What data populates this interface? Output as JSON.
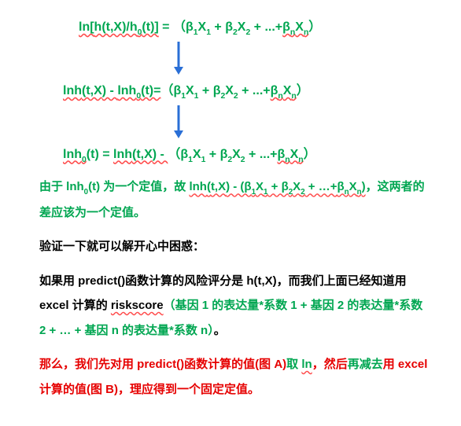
{
  "eq1": {
    "lhs_a": "ln[",
    "lhs_b": "h(t,X",
    "lhs_c": ")/h",
    "lhs_d": "(t)]",
    "eq": " = ",
    "open": "（",
    "t1a": "β",
    "t1b": "X",
    "plus1": " + ",
    "t2a": "β",
    "t2b": "X",
    "plus2": " + ...+",
    "tna": "β",
    "tnb": "X",
    "close": "）",
    "s1": "1",
    "s2": "2",
    "sn": "n",
    "s0": "0"
  },
  "eq2": {
    "lhs_a": "lnh",
    "lhs_b": "(t,X",
    "lhs_c": ") - ",
    "lhs_d": "lnh",
    "lhs_e": "(t)=",
    "open": "（",
    "t1a": "β",
    "t1b": "X",
    "plus1": " + ",
    "t2a": "β",
    "t2b": "X",
    "plus2": " + ...+",
    "tna": "β",
    "tnb": "X",
    "close": "）",
    "s1": "1",
    "s2": "2",
    "sn": "n",
    "s0": "0"
  },
  "eq3": {
    "lhs_a": "lnh",
    "lhs_b": "(t) = ",
    "lhs_c": "lnh",
    "lhs_d": "(t,X",
    "lhs_e": ") - ",
    "open": "（",
    "t1a": "β",
    "t1b": "X",
    "plus1": " + ",
    "t2a": "β",
    "t2b": "X",
    "plus2": " + ...+",
    "tna": "β",
    "tnb": "X",
    "close": "）",
    "s1": "1",
    "s2": "2",
    "sn": "n",
    "s0": "0"
  },
  "p1": {
    "a": "由于 ",
    "b": "lnh",
    "c": "(t) 为一个定值，故 ",
    "d": "lnh",
    "e": "(",
    "f": "t,X",
    "g": ") - (β",
    "h": "X",
    "i": " + β",
    "j": "X",
    "k": " + …+",
    "l": "β",
    "m": "X",
    "n": ")",
    "o": "，这两者的差应该为一个定值。",
    "s0": "0",
    "s1": "1",
    "s2": "2",
    "sn": "n"
  },
  "p2": "验证一下就可以解开心中困惑：",
  "p3": {
    "a": "如果用 ",
    "b": "predict()",
    "c": "函数计算的风险评分是 ",
    "d": "h(t,X",
    "e": ")，",
    "f": "而我们上面已经知道用 ",
    "g": "excel ",
    "h": "计算的 ",
    "i": "riskscore",
    "j": "（基因 1 的表达量*系数 1 +  基因 2 的表达量*系数 2 + … +  基因 n 的表达量*系数 n）",
    "k": "。"
  },
  "p4": {
    "a": "那么，我们先对用 ",
    "b": "predict()",
    "c": "函数计算的值(图 ",
    "d": "A)",
    "e": "取 ",
    "f": "ln",
    "g": "，然后",
    "h": "再减去",
    "i": "用 ",
    "j": "excel ",
    "k": "计算的值(图 ",
    "l": "B)",
    "m": "，理应得到一个固定定值。"
  }
}
